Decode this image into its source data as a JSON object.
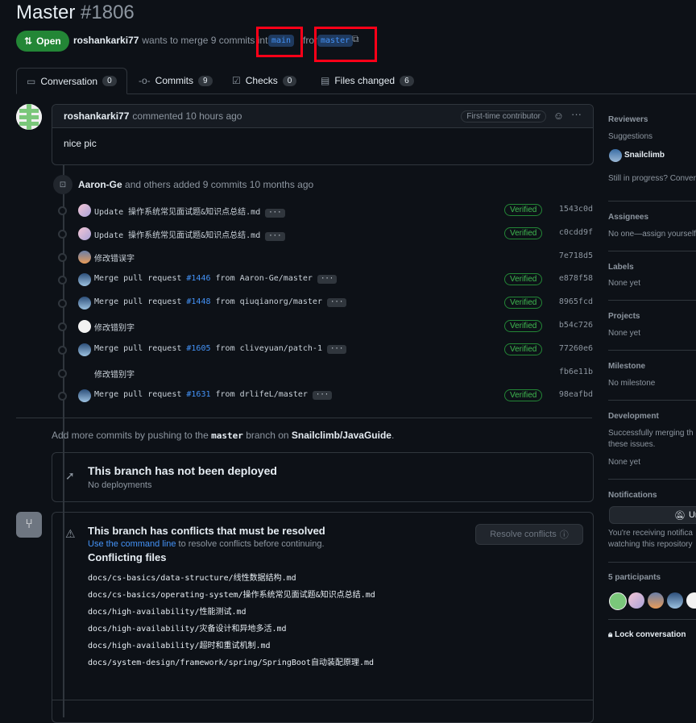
{
  "pr": {
    "title": "Master",
    "number": "#1806",
    "state": "Open",
    "author": "roshankarki77",
    "meta_text": "wants to merge 9 commits into",
    "base_branch": "main",
    "from_word": "from",
    "head_branch": "master"
  },
  "tabs": [
    {
      "label": "Conversation",
      "count": "0"
    },
    {
      "label": "Commits",
      "count": "9"
    },
    {
      "label": "Checks",
      "count": "0"
    },
    {
      "label": "Files changed",
      "count": "6"
    }
  ],
  "comment": {
    "author": "roshankarki77",
    "action": "commented 10 hours ago",
    "badge": "First-time contributor",
    "body": "nice pic"
  },
  "commits_summary": {
    "author": "Aaron-Ge",
    "text": "and others added 9 commits 10 months ago"
  },
  "commits": [
    {
      "msg": "Update 操作系统常见面试题&知识点总结.md",
      "pr": "",
      "rest": "",
      "verified": "Verified",
      "sha": "1543c0d",
      "ellipsis": true
    },
    {
      "msg": "Update 操作系统常见面试题&知识点总结.md",
      "pr": "",
      "rest": "",
      "verified": "Verified",
      "sha": "c0cdd9f",
      "ellipsis": true
    },
    {
      "msg": "修改错误字",
      "pr": "",
      "rest": "",
      "verified": "",
      "sha": "7e718d5",
      "ellipsis": false
    },
    {
      "msg": "Merge pull request ",
      "pr": "#1446",
      "rest": " from Aaron-Ge/master",
      "verified": "Verified",
      "sha": "e878f58",
      "ellipsis": true
    },
    {
      "msg": "Merge pull request ",
      "pr": "#1448",
      "rest": " from qiuqianorg/master",
      "verified": "Verified",
      "sha": "8965fcd",
      "ellipsis": true
    },
    {
      "msg": "修改错别字",
      "pr": "",
      "rest": "",
      "verified": "Verified",
      "sha": "b54c726",
      "ellipsis": false
    },
    {
      "msg": "Merge pull request ",
      "pr": "#1605",
      "rest": " from cliveyuan/patch-1",
      "verified": "Verified",
      "sha": "77260e6",
      "ellipsis": true
    },
    {
      "msg": "修改错别字",
      "pr": "",
      "rest": "",
      "verified": "",
      "sha": "fb6e11b",
      "ellipsis": false
    },
    {
      "msg": "Merge pull request ",
      "pr": "#1631",
      "rest": " from drlifeL/master",
      "verified": "Verified",
      "sha": "98eafbd",
      "ellipsis": true
    }
  ],
  "push_hint": {
    "pre": "Add more commits by pushing to the",
    "branch": "master",
    "mid": "branch on",
    "repo": "Snailclimb/JavaGuide",
    "post": "."
  },
  "deploy": {
    "title": "This branch has not been deployed",
    "sub": "No deployments"
  },
  "conflicts": {
    "title": "This branch has conflicts that must be resolved",
    "link": "Use the command line",
    "sub_rest": "to resolve conflicts before continuing.",
    "button": "Resolve conflicts",
    "files_title": "Conflicting files",
    "files": [
      "docs/cs-basics/data-structure/线性数据结构.md",
      "docs/cs-basics/operating-system/操作系统常见面试题&知识点总结.md",
      "docs/high-availability/性能测试.md",
      "docs/high-availability/灾备设计和异地多活.md",
      "docs/high-availability/超时和重试机制.md",
      "docs/system-design/framework/spring/SpringBoot自动装配原理.md"
    ]
  },
  "sidebar": {
    "reviewers": {
      "heading": "Reviewers",
      "suggestions": "Suggestions",
      "user": "Snailclimb",
      "note": "Still in progress? Conver"
    },
    "assignees": {
      "heading": "Assignees",
      "text": "No one—assign yourself"
    },
    "labels": {
      "heading": "Labels",
      "text": "None yet"
    },
    "projects": {
      "heading": "Projects",
      "text": "None yet"
    },
    "milestone": {
      "heading": "Milestone",
      "text": "No milestone"
    },
    "development": {
      "heading": "Development",
      "text1": "Successfully merging th",
      "text2": "these issues.",
      "text3": "None yet"
    },
    "notifications": {
      "heading": "Notifications",
      "button": "Un",
      "text1": "You're receiving notifica",
      "text2": "watching this repository"
    },
    "participants": {
      "heading": "5 participants"
    },
    "lock": "Lock conversation"
  },
  "colors": {
    "accent": "#4493f8",
    "open": "#238636",
    "highlight": "#ff0018"
  }
}
